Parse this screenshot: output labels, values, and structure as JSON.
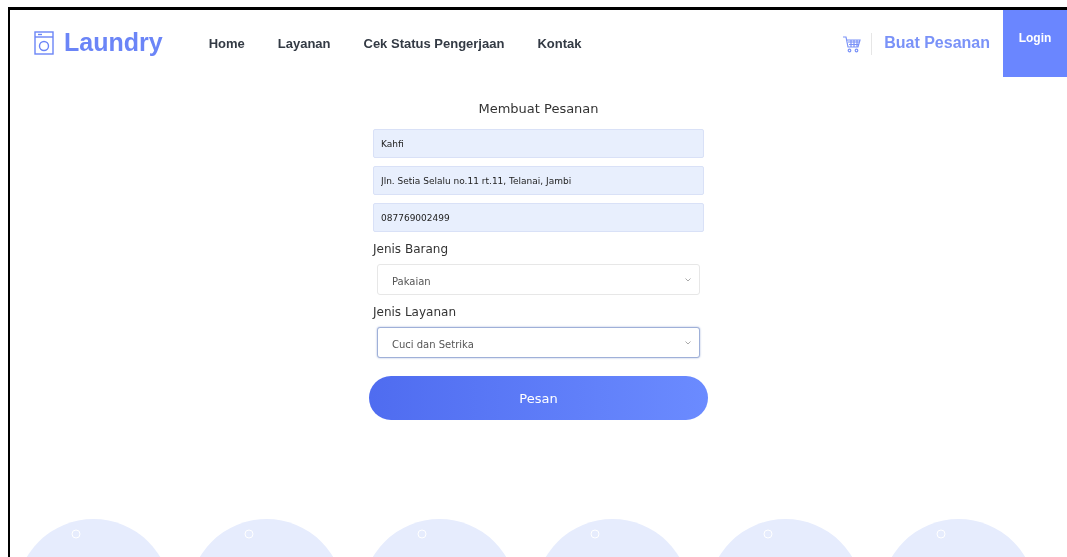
{
  "brand": {
    "name": "Laundry"
  },
  "nav": [
    "Home",
    "Layanan",
    "Cek Status Pengerjaan",
    "Kontak"
  ],
  "actions": {
    "order_link": "Buat Pesanan",
    "login": "Login"
  },
  "form": {
    "title": "Membuat Pesanan",
    "fields": [
      {
        "kind": "text",
        "value": "Kahfi"
      },
      {
        "kind": "text",
        "value": "Jln. Setia Selalu no.11 rt.11, Telanai, Jambi"
      },
      {
        "kind": "text",
        "value": "087769002499"
      },
      {
        "kind": "select",
        "label": "Jenis Barang",
        "value": "Pakaian",
        "focused": false
      },
      {
        "kind": "select",
        "label": "Jenis Layanan",
        "value": "Cuci dan Setrika",
        "focused": true
      }
    ],
    "submit": "Pesan"
  }
}
